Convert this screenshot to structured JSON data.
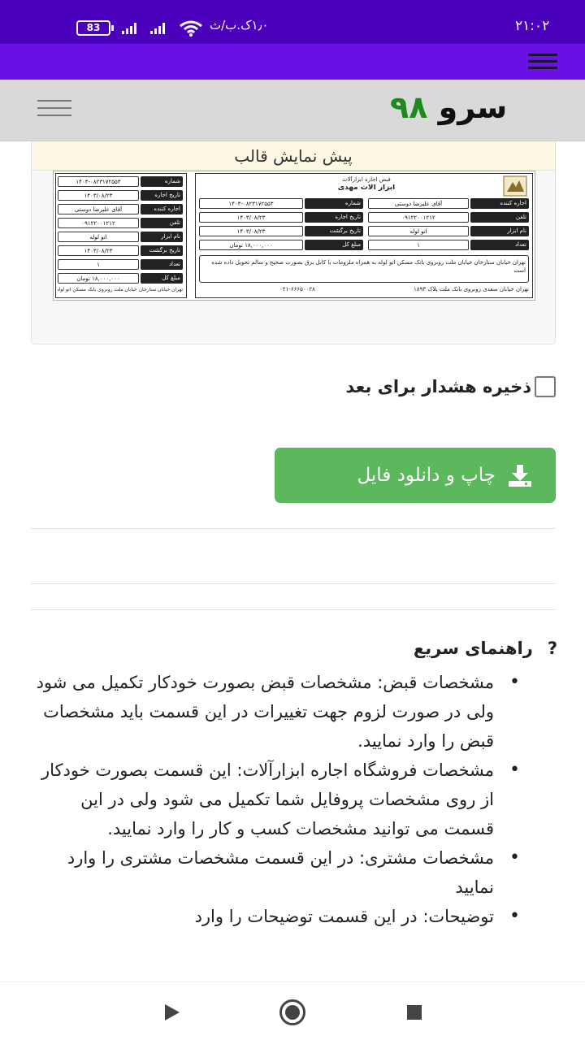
{
  "status_bar": {
    "time": "۲۱:۰۲",
    "network_speed": "۱٫۰ک.ب/ث",
    "battery": "83"
  },
  "header": {
    "logo_text": "سرو",
    "logo_number": "۹۸"
  },
  "preview": {
    "title": "پیش نمایش قالب",
    "receipt": {
      "heading": "قبض اجاره ابزارآلات",
      "shop_name": "ابزار آلات مهدی",
      "stub": [
        {
          "label": "شماره",
          "value": "۱۴۰۳-۰۸۲۳۱۷۲۵۵۳"
        },
        {
          "label": "تاریخ اجاره",
          "value": "۱۴۰۳/۰۸/۲۳"
        },
        {
          "label": "اجاره کننده",
          "value": "آقای علیرضا دوستی"
        },
        {
          "label": "تلفن",
          "value": "۰۹۱۲۲۰۰۱۲۱۲"
        },
        {
          "label": "نام ابزار",
          "value": "اتو لوله"
        },
        {
          "label": "تاریخ برگشت",
          "value": "۱۴۰۳/۰۸/۲۳"
        },
        {
          "label": "تعداد",
          "value": "۱"
        },
        {
          "label": "مبلغ کل",
          "value": "۱۸,۰۰۰,۰۰۰ تومان"
        }
      ],
      "main_right": [
        {
          "label": "اجاره کننده",
          "value": "آقای علیرضا دوستی"
        },
        {
          "label": "تلفن",
          "value": "۰۹۱۲۲۰۰۱۲۱۲"
        },
        {
          "label": "نام ابزار",
          "value": "اتو لوله"
        },
        {
          "label": "تعداد",
          "value": "۱"
        }
      ],
      "main_left": [
        {
          "label": "شماره",
          "value": "۱۴۰۳-۰۸۲۳۱۷۲۵۵۳"
        },
        {
          "label": "تاریخ اجاره",
          "value": "۱۴۰۳/۰۸/۲۳"
        },
        {
          "label": "تاریخ برگشت",
          "value": "۱۴۰۳/۰۸/۲۳"
        },
        {
          "label": "مبلغ کل",
          "value": "۱۸,۰۰۰,۰۰۰ تومان"
        }
      ],
      "description": "تهران خیابان ستارخان خیابان ملت روبروی بانک مسکن اتو لوله به همراه ملزومات با کابل برق بصورت صحیح و سالم تحویل داده شده است",
      "address": "تهران خیابان سعدی روبروی بانک ملت پلاک ۱۸۹۳",
      "phone": "۰۲۱-۶۶۶۵۰۰۲۸",
      "stub_footer": "تهران خیابان ستارخان خیابان ملت روبروی بانک مسکن اتو لوله به همراه ملزومات"
    }
  },
  "save_warning": {
    "label": "ذخیره هشدار برای بعد",
    "checked": false
  },
  "download_button": {
    "label": "چاپ و دانلود فایل"
  },
  "guide": {
    "title": "راهنمای سریع",
    "icon": "?",
    "items": [
      "مشخصات قبض: مشخصات قبض بصورت خودکار تکمیل می شود ولی در صورت لزوم جهت تغییرات در این قسمت باید مشخصات قبض را وارد نمایید.",
      "مشخصات فروشگاه اجاره ابزارآلات: این قسمت بصورت خودکار از روی مشخصات پروفایل شما تکمیل می شود ولی در این قسمت می توانید مشخصات کسب و کار را وارد نمایید.",
      "مشخصات مشتری: در این قسمت مشخصات مشتری را وارد نمایید",
      "توضیحات: در این قسمت توضیحات را وارد"
    ]
  },
  "colors": {
    "statusbar": "#4b00bc",
    "topbar": "#6a0fe6",
    "button_green": "#5cb85c",
    "logo_green": "#1c8a1c",
    "preview_head": "#fcf8e3"
  }
}
